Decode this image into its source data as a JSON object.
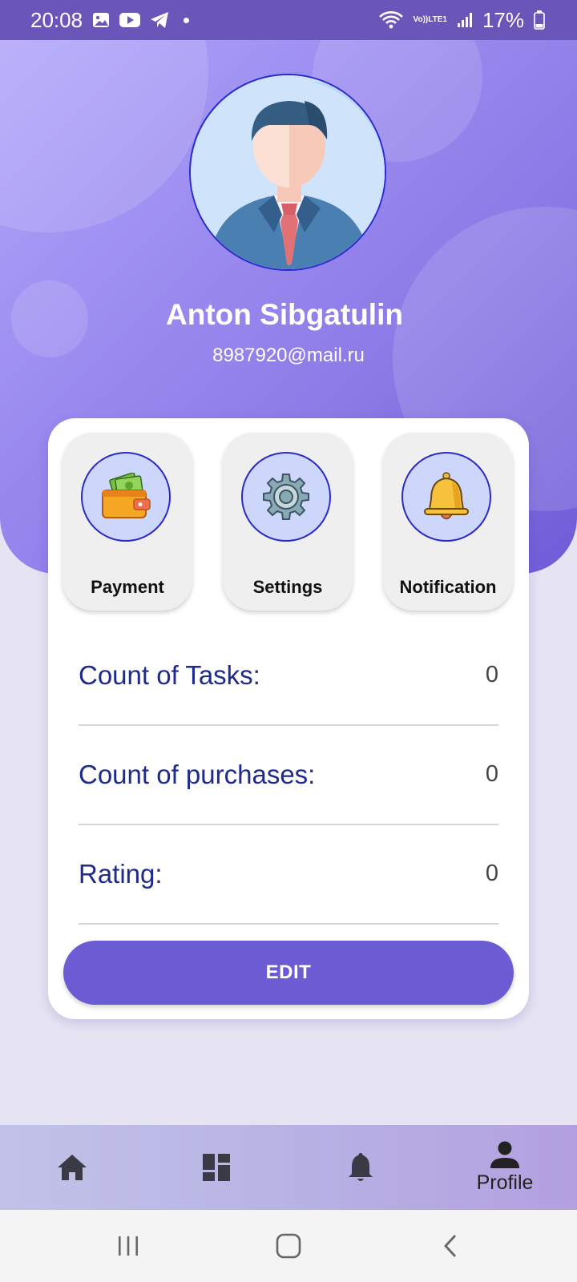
{
  "status_bar": {
    "time": "20:08",
    "battery": "17%",
    "lte_top": "Vo))",
    "lte_bottom": "LTE1",
    "left_icons": [
      "gallery-icon",
      "youtube-icon",
      "telegram-icon",
      "dot-icon"
    ],
    "right_icons": [
      "wifi-icon",
      "volte-icon",
      "signal-icon",
      "battery-icon"
    ]
  },
  "profile": {
    "name": "Anton Sibgatulin",
    "email": "8987920@mail.ru"
  },
  "tiles": [
    {
      "label": "Payment",
      "icon": "wallet-icon"
    },
    {
      "label": "Settings",
      "icon": "gear-icon"
    },
    {
      "label": "Notification",
      "icon": "bell-icon"
    }
  ],
  "stats": [
    {
      "label": "Count of Tasks:",
      "value": "0"
    },
    {
      "label": "Count of purchases:",
      "value": "0"
    },
    {
      "label": "Rating:",
      "value": "0"
    }
  ],
  "edit_button": {
    "label": "EDIT"
  },
  "bottom_nav": {
    "items": [
      {
        "icon": "home-icon",
        "label": ""
      },
      {
        "icon": "dashboard-icon",
        "label": ""
      },
      {
        "icon": "bell-icon",
        "label": ""
      },
      {
        "icon": "person-icon",
        "label": "Profile",
        "active": true
      }
    ]
  },
  "colors": {
    "accent": "#6b5cd3",
    "status_bar": "#6a56b9",
    "stat_label": "#1e2a8c"
  }
}
